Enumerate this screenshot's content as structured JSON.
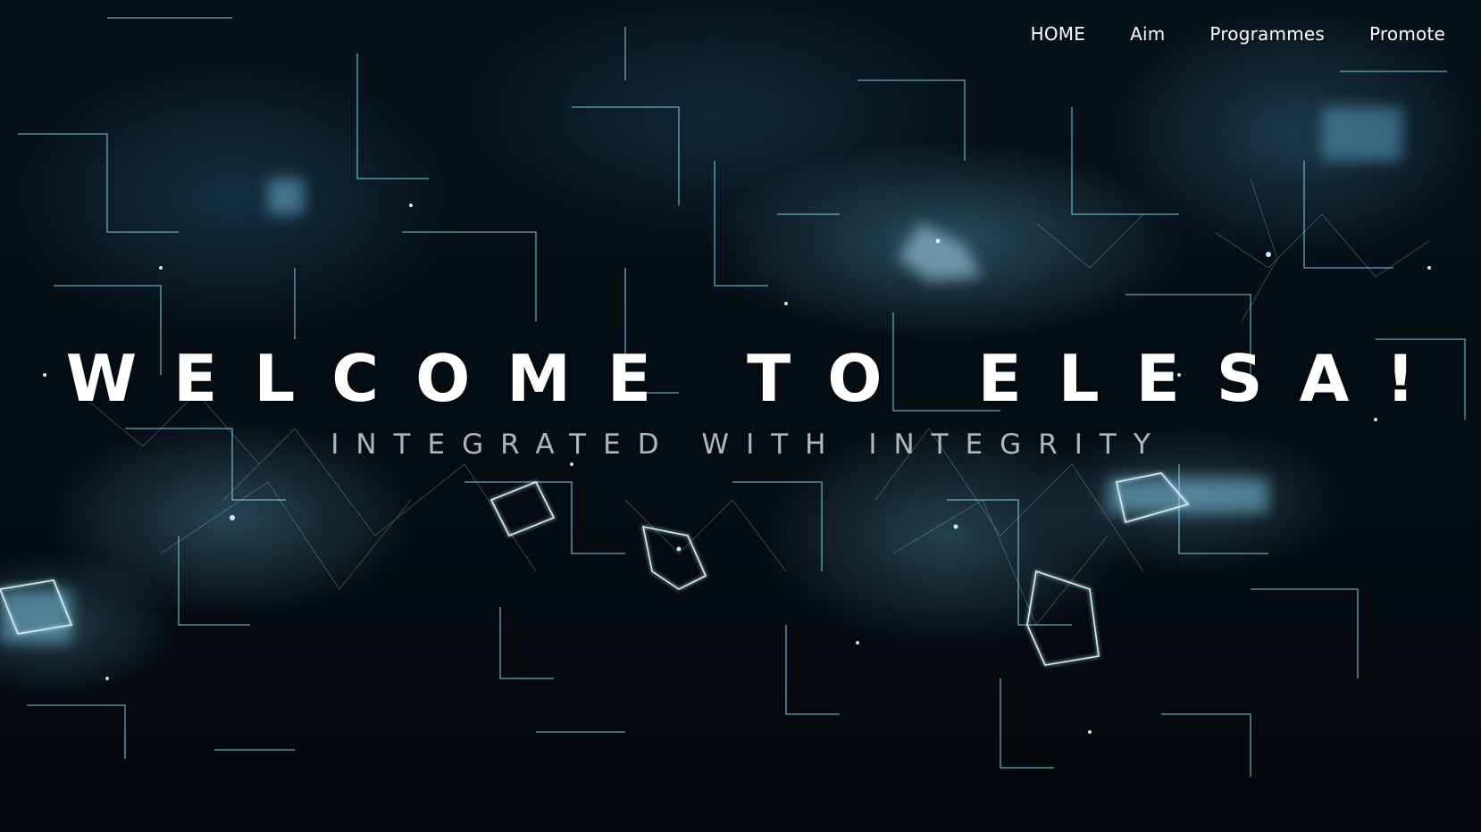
{
  "nav": {
    "items": [
      {
        "label": "HOME"
      },
      {
        "label": "Aim"
      },
      {
        "label": "Programmes"
      },
      {
        "label": "Promote"
      }
    ]
  },
  "hero": {
    "title": "WELCOME TO ELESA!",
    "subtitle": "INTEGRATED WITH INTEGRITY"
  },
  "colors": {
    "background": "#03080c",
    "network_line": "#8fd3ee",
    "text": "#ffffff"
  }
}
